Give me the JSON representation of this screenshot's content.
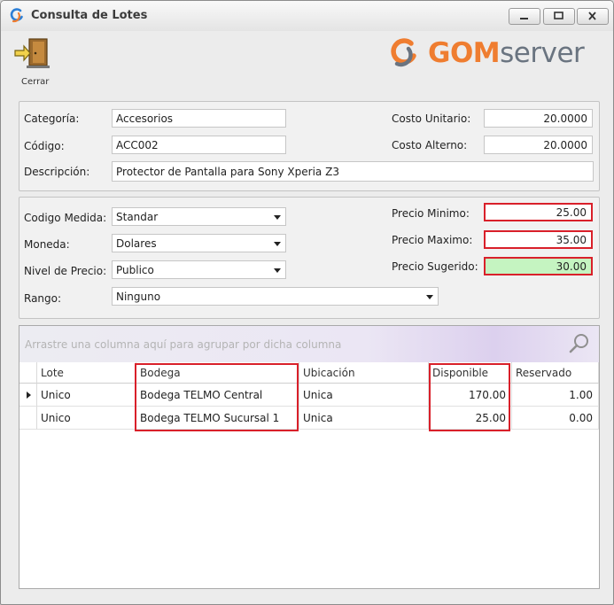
{
  "window": {
    "title": "Consulta de Lotes"
  },
  "toolbar": {
    "close_label": "Cerrar"
  },
  "logo": {
    "brand_part1": "GOM",
    "brand_part2": "server",
    "orange": "#ef7d30",
    "gray": "#6a7480"
  },
  "product": {
    "categoria_label": "Categoría:",
    "categoria_value": "Accesorios",
    "codigo_label": "Código:",
    "codigo_value": "ACC002",
    "descripcion_label": "Descripción:",
    "descripcion_value": "Protector de Pantalla para Sony Xperia Z3",
    "costo_unitario_label": "Costo Unitario:",
    "costo_unitario_value": "20.0000",
    "costo_alterno_label": "Costo Alterno:",
    "costo_alterno_value": "20.0000"
  },
  "pricing": {
    "codigo_medida_label": "Codigo Medida:",
    "codigo_medida_value": "Standar",
    "moneda_label": "Moneda:",
    "moneda_value": "Dolares",
    "nivel_precio_label": "Nivel de Precio:",
    "nivel_precio_value": "Publico",
    "rango_label": "Rango:",
    "rango_value": "Ninguno",
    "precio_minimo_label": "Precio Minimo:",
    "precio_minimo_value": "25.00",
    "precio_maximo_label": "Precio Maximo:",
    "precio_maximo_value": "35.00",
    "precio_sugerido_label": "Precio Sugerido:",
    "precio_sugerido_value": "30.00"
  },
  "grid": {
    "group_hint": "Arrastre una columna aquí para agrupar por dicha columna",
    "columns": [
      "Lote",
      "Bodega",
      "Ubicación",
      "Disponible",
      "Reservado"
    ],
    "rows": [
      {
        "lote": "Unico",
        "bodega": "Bodega TELMO Central",
        "ubicacion": "Unica",
        "disponible": "170.00",
        "reservado": "1.00"
      },
      {
        "lote": "Unico",
        "bodega": "Bodega TELMO Sucursal 1",
        "ubicacion": "Unica",
        "disponible": "25.00",
        "reservado": "0.00"
      }
    ]
  },
  "colors": {
    "highlight_red": "#d9202a",
    "suggested_green": "#c5f4c1"
  }
}
